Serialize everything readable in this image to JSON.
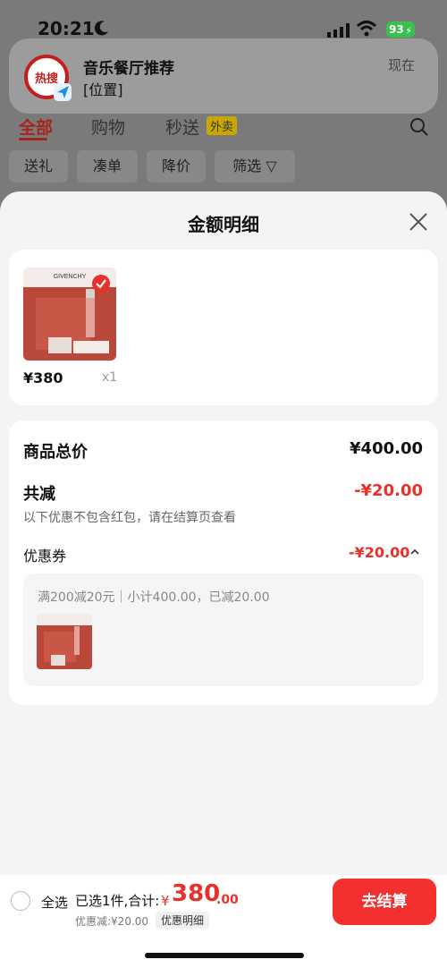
{
  "status": {
    "time": "20:21",
    "battery": "93"
  },
  "notification": {
    "avatar_text": "热搜",
    "title": "音乐餐厅推荐",
    "body": "[位置]",
    "time": "现在"
  },
  "bg_tabs": [
    "全部",
    "购物",
    "秒送"
  ],
  "bg_badge": "外卖",
  "bg_filters": [
    "送礼",
    "凑单",
    "降价",
    "筛选 ▽"
  ],
  "sheet": {
    "title": "金额明细",
    "product": {
      "price": "¥380",
      "qty": "x1",
      "brand": "GIVENCHY"
    },
    "summary": {
      "total_label": "商品总价",
      "total_value": "¥400.00",
      "reduce_label": "共减",
      "reduce_value": "-¥20.00",
      "note": "以下优惠不包含红包，请在结算页查看",
      "coupon_label": "优惠券",
      "coupon_value": "-¥20.00",
      "coupon_detail": "满200减20元｜小计400.00，已减20.00"
    },
    "colors": {
      "accent": "#e8312a",
      "checkout": "#f23030"
    }
  },
  "bottom_bar": {
    "select_all": "全选",
    "selected": "已选1件,合计:",
    "currency": "¥",
    "total_int": "380",
    "total_dec": ".00",
    "discount": "优惠减:¥20.00",
    "detail_chip": "优惠明细",
    "checkout": "去结算"
  }
}
